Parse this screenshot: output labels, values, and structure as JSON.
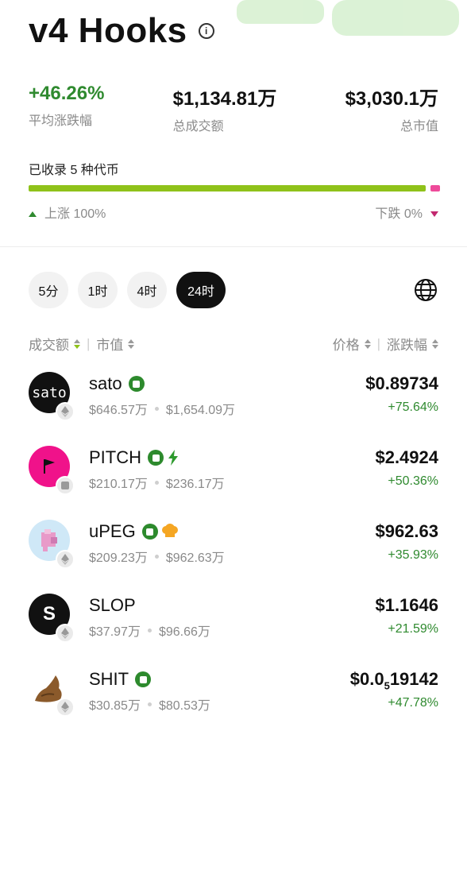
{
  "header": {
    "title": "v4 Hooks",
    "info_icon": "info-icon"
  },
  "stats": [
    {
      "value": "+46.26%",
      "label": "平均涨跌幅"
    },
    {
      "value": "$1,134.81万",
      "label": "总成交额"
    },
    {
      "value": "$3,030.1万",
      "label": "总市值"
    }
  ],
  "coverage": {
    "label": "已收录 5 种代币",
    "up_fraction": 1.0,
    "up_label": "上涨 100%",
    "down_label": "下跌 0%",
    "up_color": "#8fc21a",
    "down_color": "#ee4a9a"
  },
  "tabs": [
    {
      "label": "5分"
    },
    {
      "label": "1时"
    },
    {
      "label": "4时"
    },
    {
      "label": "24时",
      "active": true
    }
  ],
  "columns": {
    "volume": "成交额",
    "mcap": "市值",
    "price": "价格",
    "change": "涨跌幅"
  },
  "tokens": [
    {
      "name": "sato",
      "volume": "$646.57万",
      "mcap": "$1,654.09万",
      "price": "$0.89734",
      "change": "+75.64%",
      "avatar_text": "sato"
    },
    {
      "name": "PITCH",
      "volume": "$210.17万",
      "mcap": "$236.17万",
      "price": "$2.4924",
      "change": "+50.36%"
    },
    {
      "name": "uPEG",
      "volume": "$209.23万",
      "mcap": "$962.63万",
      "price": "$962.63",
      "change": "+35.93%"
    },
    {
      "name": "SLOP",
      "volume": "$37.97万",
      "mcap": "$96.66万",
      "price": "$1.1646",
      "change": "+21.59%",
      "avatar_text": "S"
    },
    {
      "name": "SHIT",
      "volume": "$30.85万",
      "mcap": "$80.53万",
      "price_prefix": "$0.0",
      "price_sub": "5",
      "price_rest": "19142",
      "change": "+47.78%"
    }
  ]
}
